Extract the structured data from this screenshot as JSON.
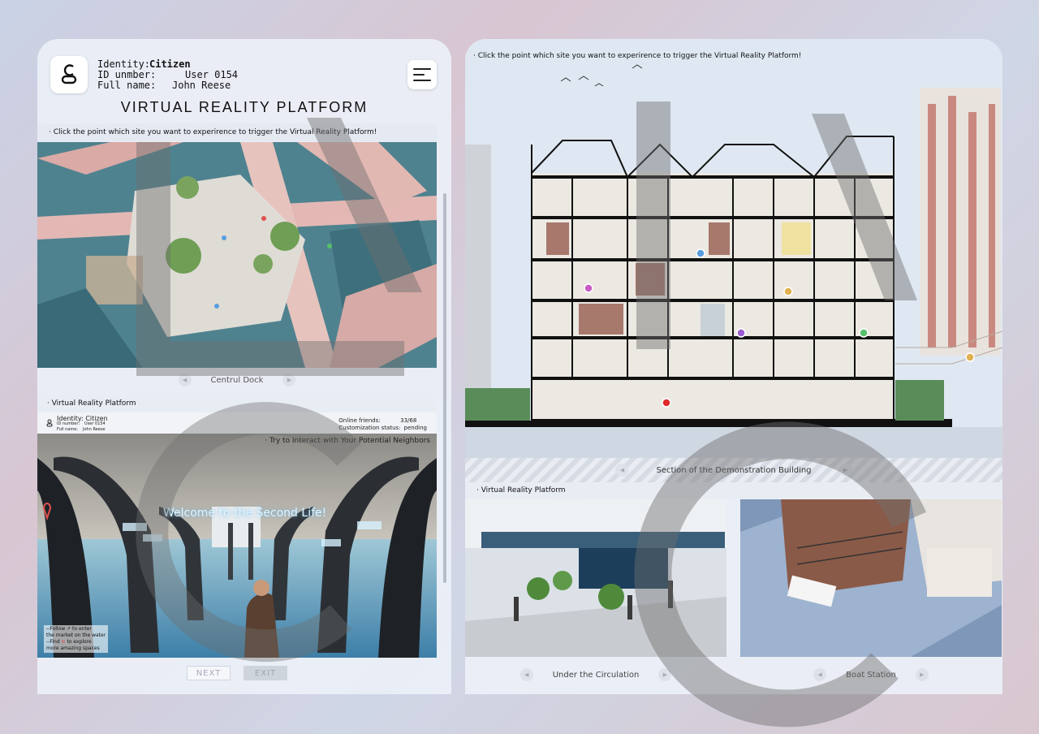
{
  "profile": {
    "identity_key": "Identity:",
    "identity_val": "Citizen",
    "id_key": "ID unmber:",
    "id_val": "User 0154",
    "name_key": "Full name:",
    "name_val": "John Reese"
  },
  "title": "VIRTUAL REALITY PLATFORM",
  "instruction": "· Click the point which site you want to experirence to trigger the Virtual Reality Platform!",
  "map_caption": "Centrul Dock",
  "vr_section": "· Virtual Reality Platform",
  "hud": {
    "identity": "Identity: Citizen",
    "id_number": "ID number:",
    "id_val": "User 0154",
    "full_name": "Full name:",
    "name_val": "John Reese",
    "online_label": "Online friends:",
    "online_val": "33/68",
    "custom_label": "Customization status:",
    "custom_val": "pending"
  },
  "vr": {
    "neighbors": "· Try to Interact with Your Potential Neighbors",
    "welcome": "Welcome to the Second Life!",
    "hint1": "--Follow",
    "hint1b": "to enter",
    "hint2": "the market on the water",
    "hint3": "--Find",
    "hint3b": "to explore",
    "hint4": "more amazing spaces"
  },
  "buttons": {
    "next": "NEXT",
    "exit": "EXIT"
  },
  "right": {
    "instruction": "· Click the point which site you want to experirence to trigger the Virtual Reality Platform!",
    "section_caption": "Section of the Demonstration Building",
    "vr_label": "· Virtual Reality Platform",
    "thumb1": "Under the Circulation",
    "thumb2": "Boat Station"
  },
  "colors": {
    "accent": "#e05050",
    "panel": "#ecf0f7"
  }
}
